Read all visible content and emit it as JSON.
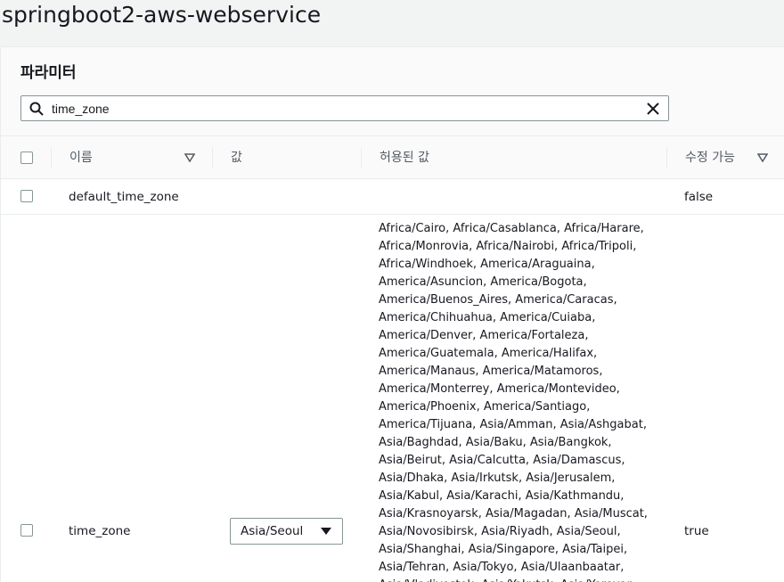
{
  "page": {
    "title": "springboot2-aws-webservice"
  },
  "panel": {
    "title": "파라미터",
    "search": {
      "value": "time_zone",
      "placeholder": ""
    }
  },
  "table": {
    "columns": {
      "name": "이름",
      "value": "값",
      "allowed": "허용된 값",
      "modifiable": "수정 가능"
    },
    "rows": [
      {
        "name": "default_time_zone",
        "value": "",
        "allowed": "",
        "modifiable": "false"
      },
      {
        "name": "time_zone",
        "value": "Asia/Seoul",
        "allowed": "Africa/Cairo, Africa/Casablanca, Africa/Harare, Africa/Monrovia, Africa/Nairobi, Africa/Tripoli, Africa/Windhoek, America/Araguaina, America/Asuncion, America/Bogota, America/Buenos_Aires, America/Caracas, America/Chihuahua, America/Cuiaba, America/Denver, America/Fortaleza, America/Guatemala, America/Halifax, America/Manaus, America/Matamoros, America/Monterrey, America/Montevideo, America/Phoenix, America/Santiago, America/Tijuana, Asia/Amman, Asia/Ashgabat, Asia/Baghdad, Asia/Baku, Asia/Bangkok, Asia/Beirut, Asia/Calcutta, Asia/Damascus, Asia/Dhaka, Asia/Irkutsk, Asia/Jerusalem, Asia/Kabul, Asia/Karachi, Asia/Kathmandu, Asia/Krasnoyarsk, Asia/Magadan, Asia/Muscat, Asia/Novosibirsk, Asia/Riyadh, Asia/Seoul, Asia/Shanghai, Asia/Singapore, Asia/Taipei, Asia/Tehran, Asia/Tokyo, Asia/Ulaanbaatar, Asia/Vladivostok, Asia/Yakutsk, Asia/Yerevan",
        "modifiable": "true"
      }
    ]
  },
  "icons": {
    "search": "search-icon",
    "clear": "close-icon",
    "sort": "sort-down-icon",
    "select": "caret-down-icon"
  },
  "colors": {
    "border": "#879596",
    "header_bg": "#fafafa",
    "text": "#16191f",
    "muted": "#545b64"
  }
}
